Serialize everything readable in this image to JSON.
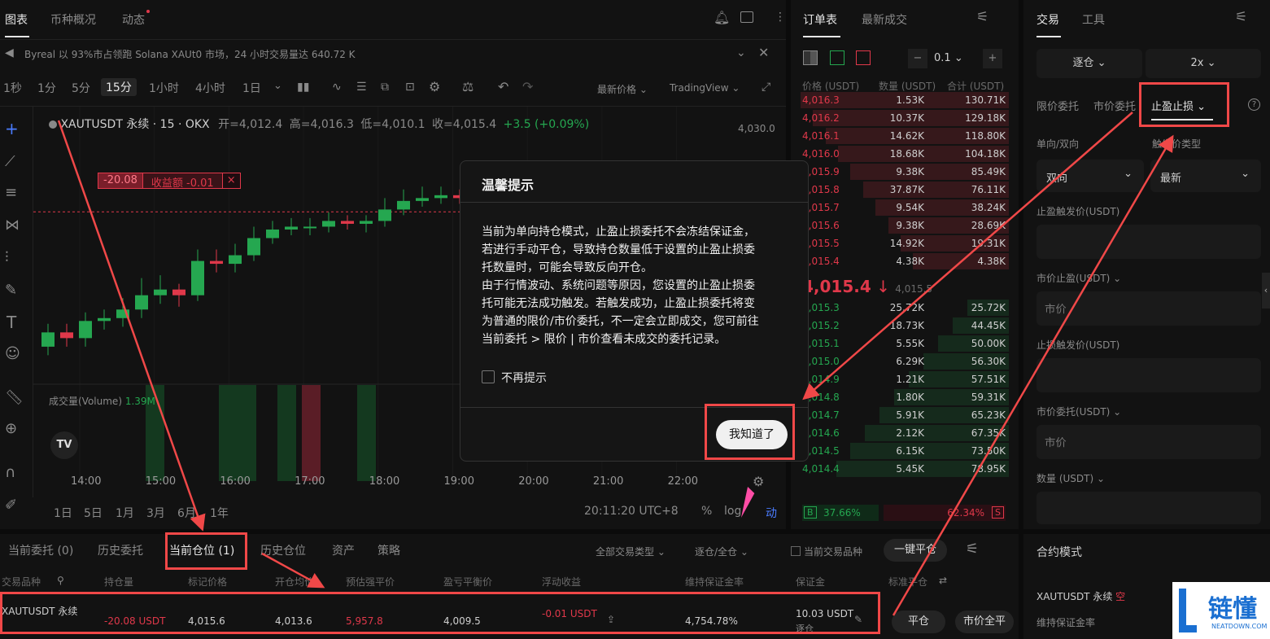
{
  "top_tabs": {
    "chart": "图表",
    "overview": "币种概况",
    "news": "动态"
  },
  "ticker_news": "Byreal 以 93%市占领跑 Solana XAUt0 市场，24 小时交易量达 640.72 K",
  "timeframes": [
    "1秒",
    "1分",
    "5分",
    "15分",
    "1小时",
    "4小时",
    "1日"
  ],
  "active_timeframe": "15分",
  "toolbar": {
    "latest_price": "最新价格",
    "tradingview": "TradingView"
  },
  "chart_header": {
    "title": "XAUTUSDT 永续 · 15 · OKX",
    "open_label": "开=4,012.4",
    "high_label": "高=4,016.3",
    "low_label": "低=4,010.1",
    "close_label": "收=4,015.4",
    "change": "+3.5 (+0.09%)"
  },
  "position_line": {
    "qty": "-20.08",
    "pnl": "收益额 -0.01",
    "close": "×"
  },
  "volume_label": "成交量(Volume)",
  "volume_value": "1.39M",
  "price_axis": {
    "top": "4,030.0"
  },
  "time_axis": [
    "14:00",
    "15:00",
    "16:00",
    "17:00",
    "18:00",
    "19:00",
    "20:00",
    "21:00",
    "22:00"
  ],
  "ranges": [
    "1日",
    "5日",
    "1月",
    "3月",
    "6月",
    "1年"
  ],
  "clock": "20:11:20 UTC+8",
  "log_label": "log",
  "pct_label": "%",
  "auto_label": "动",
  "chart_data": {
    "type": "candlestick",
    "x": [
      "13:30",
      "13:45",
      "14:00",
      "14:15",
      "14:30",
      "14:45",
      "15:00",
      "15:15",
      "15:30",
      "15:45",
      "16:00",
      "16:15",
      "16:30",
      "16:45",
      "17:00",
      "17:15",
      "17:30",
      "17:45",
      "18:00",
      "18:15",
      "18:30",
      "18:45",
      "19:00",
      "19:15",
      "19:30",
      "19:45",
      "20:00"
    ],
    "open": [
      3990.0,
      3992.5,
      3991.5,
      3994.5,
      3995.0,
      3996.5,
      3999.0,
      4000.0,
      3999.0,
      4005.0,
      4004.5,
      4006.0,
      4009.0,
      4010.5,
      4011.0,
      4011.0,
      4012.0,
      4011.5,
      4012.0,
      4014.0,
      4015.5,
      4016.0,
      4016.5,
      4016.0,
      4015.5,
      4016.0,
      4015.2
    ],
    "close": [
      3992.5,
      3991.5,
      3994.5,
      3995.0,
      3996.5,
      3999.0,
      4000.0,
      3999.0,
      4005.0,
      4004.5,
      4006.0,
      4009.0,
      4010.5,
      4011.0,
      4011.0,
      4012.0,
      4011.5,
      4012.0,
      4014.0,
      4015.5,
      4016.0,
      4016.5,
      4016.0,
      4015.5,
      4016.0,
      4015.2,
      4015.4
    ],
    "high": [
      3994.0,
      3994.0,
      3996.0,
      3996.5,
      3998.5,
      4002.0,
      4002.5,
      4001.0,
      4007.0,
      4007.0,
      4008.0,
      4011.0,
      4012.0,
      4012.5,
      4012.5,
      4013.5,
      4013.0,
      4013.0,
      4016.0,
      4017.5,
      4018.0,
      4018.0,
      4017.5,
      4017.0,
      4017.5,
      4016.5,
      4016.3
    ],
    "low": [
      3988.5,
      3990.0,
      3990.0,
      3993.0,
      3993.5,
      3995.0,
      3997.5,
      3997.0,
      3998.0,
      4003.0,
      4003.0,
      4005.0,
      4008.0,
      4009.5,
      4009.5,
      4010.0,
      4010.5,
      4010.0,
      4011.0,
      4013.0,
      4014.5,
      4015.0,
      4015.0,
      4014.5,
      4014.5,
      4014.5,
      4010.1
    ],
    "ylim": [
      3985,
      4032
    ]
  },
  "orderbook": {
    "tab_orderbook": "订单表",
    "tab_trades": "最新成交",
    "precision": "0.1",
    "col_price": "价格 (USDT)",
    "col_qty": "数量 (USDT)",
    "col_total": "合计 (USDT)",
    "asks": [
      {
        "price": "4,016.3",
        "qty": "1.53K",
        "total": "130.71K"
      },
      {
        "price": "4,016.2",
        "qty": "10.37K",
        "total": "129.18K"
      },
      {
        "price": "4,016.1",
        "qty": "14.62K",
        "total": "118.80K"
      },
      {
        "price": "4,016.0",
        "qty": "18.68K",
        "total": "104.18K"
      },
      {
        "price": "4,015.9",
        "qty": "9.38K",
        "total": "85.49K"
      },
      {
        "price": "4,015.8",
        "qty": "37.87K",
        "total": "76.11K"
      },
      {
        "price": "4,015.7",
        "qty": "9.54K",
        "total": "38.24K"
      },
      {
        "price": "4,015.6",
        "qty": "9.38K",
        "total": "28.69K"
      },
      {
        "price": "4,015.5",
        "qty": "14.92K",
        "total": "19.31K"
      },
      {
        "price": "4,015.4",
        "qty": "4.38K",
        "total": "4.38K"
      }
    ],
    "mid_price": "4,015.4",
    "mid_arrow": "↓",
    "mid_ref": "4,015.5",
    "bids": [
      {
        "price": "4,015.3",
        "qty": "25.72K",
        "total": "25.72K"
      },
      {
        "price": "4,015.2",
        "qty": "18.73K",
        "total": "44.45K"
      },
      {
        "price": "4,015.1",
        "qty": "5.55K",
        "total": "50.00K"
      },
      {
        "price": "4,015.0",
        "qty": "6.29K",
        "total": "56.30K"
      },
      {
        "price": "4,014.9",
        "qty": "1.21K",
        "total": "57.51K"
      },
      {
        "price": "4,014.8",
        "qty": "1.80K",
        "total": "59.31K"
      },
      {
        "price": "4,014.7",
        "qty": "5.91K",
        "total": "65.23K"
      },
      {
        "price": "4,014.6",
        "qty": "2.12K",
        "total": "67.35K"
      },
      {
        "price": "4,014.5",
        "qty": "6.15K",
        "total": "73.50K"
      },
      {
        "price": "4,014.4",
        "qty": "5.45K",
        "total": "78.95K"
      }
    ],
    "buy_tag": "B",
    "buy_pct": "37.66%",
    "sell_pct": "62.34%",
    "sell_tag": "S"
  },
  "trade_panel": {
    "tab_trade": "交易",
    "tab_tools": "工具",
    "margin_mode": "逐仓",
    "leverage": "2x",
    "order_types": [
      "限价委托",
      "市价委托",
      "止盈止损"
    ],
    "active_order_type": "止盈止损",
    "direction_label": "单向/双向",
    "trigger_type_label": "触发价类型",
    "direction_value": "双向",
    "trigger_value": "最新",
    "tp_trigger_label": "止盈触发价(USDT)",
    "tp_market_label": "市价止盈(USDT)",
    "tp_market_placeholder": "市价",
    "sl_trigger_label": "止损触发价(USDT)",
    "sl_market_label": "市价委托(USDT)",
    "sl_market_placeholder": "市价",
    "qty_label": "数量 (USDT)",
    "contract_mode": "合约模式",
    "contract_symbol": "XAUTUSDT 永续",
    "contract_side": "空",
    "maint_margin": "维持保证金率"
  },
  "modal": {
    "title": "温馨提示",
    "body_lines": [
      "当前为单向持仓模式，止盈止损委托不会冻结保证金，",
      "若进行手动平仓，导致持仓数量低于设置的止盈止损委",
      "托数量时，可能会导致反向开仓。",
      "由于行情波动、系统问题等原因，您设置的止盈止损委",
      "托可能无法成功触发。若触发成功，止盈止损委托将变",
      "为普通的限价/市价委托，不一定会立即成交，您可前往",
      "当前委托 > 限价 | 市价查看未成交的委托记录。"
    ],
    "checkbox": "不再提示",
    "confirm": "我知道了"
  },
  "bottom": {
    "tabs": [
      "当前委托 (0)",
      "历史委托",
      "当前仓位 (1)",
      "历史仓位",
      "资产",
      "策略"
    ],
    "active_tab": "当前仓位 (1)",
    "filter_type": "全部交易类型",
    "filter_mode": "逐仓/全仓",
    "current_symbol_only": "当前交易品种",
    "close_all": "一键平仓",
    "columns": [
      "交易品种",
      "持仓量",
      "标记价格",
      "开仓均价",
      "预估强平价",
      "盈亏平衡价",
      "浮动收益",
      "维持保证金率",
      "保证金",
      "标准平仓"
    ],
    "row": {
      "symbol": "XAUTUSDT 永续",
      "position": "-20.08 USDT",
      "mark_price": "4,015.6",
      "entry_price": "4,013.6",
      "liq_price": "5,957.8",
      "breakeven": "4,009.5",
      "pnl": "-0.01 USDT",
      "maint_ratio": "4,754.78%",
      "margin": "10.03 USDT",
      "margin_mode": "逐仓",
      "close_btn": "平仓",
      "market_close_btn": "市价全平"
    }
  },
  "watermark": {
    "brand": "链懂",
    "site": "NEATDOWN.COM"
  },
  "colors": {
    "up": "#25a750",
    "down": "#e0384a",
    "annotation": "#f04848"
  }
}
